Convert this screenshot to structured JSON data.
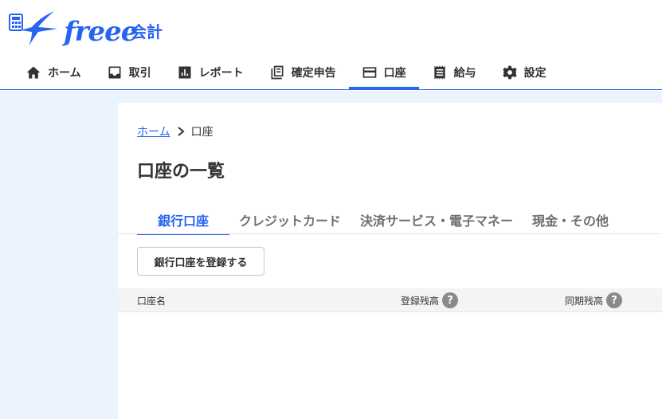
{
  "brand": {
    "logo_text": "freee",
    "product": "会計",
    "color": "#2864f0"
  },
  "nav": [
    {
      "label": "ホーム",
      "icon": "home-icon"
    },
    {
      "label": "取引",
      "icon": "inbox-icon"
    },
    {
      "label": "レポート",
      "icon": "bar-chart-icon"
    },
    {
      "label": "確定申告",
      "icon": "document-stack-icon"
    },
    {
      "label": "口座",
      "icon": "credit-card-icon",
      "active": true
    },
    {
      "label": "給与",
      "icon": "receipt-icon"
    },
    {
      "label": "設定",
      "icon": "gear-icon"
    }
  ],
  "breadcrumb": {
    "home": "ホーム",
    "current": "口座"
  },
  "page_title": "口座の一覧",
  "tabs": [
    {
      "label": "銀行口座",
      "active": true
    },
    {
      "label": "クレジットカード"
    },
    {
      "label": "決済サービス・電子マネー"
    },
    {
      "label": "現金・その他"
    }
  ],
  "register_button": "銀行口座を登録する",
  "table": {
    "headers": {
      "name": "口座名",
      "registered_balance": "登録残高",
      "synced_balance": "同期残高"
    },
    "help_glyph": "?"
  }
}
